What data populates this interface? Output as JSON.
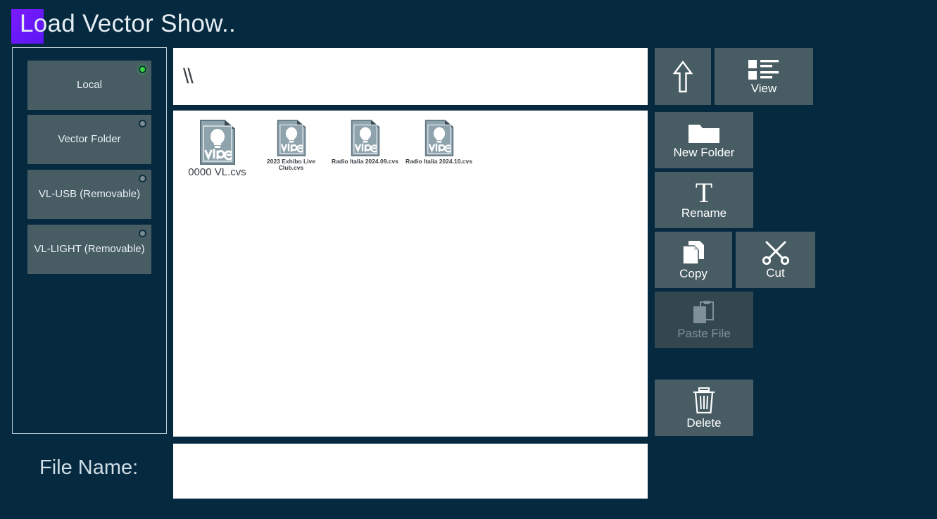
{
  "window": {
    "title": "Load Vector Show..",
    "accent_color": "#6a18fb",
    "background_color": "#05293f",
    "button_color": "#475c63",
    "panel_color": "#ffffff"
  },
  "sidebar": {
    "items": [
      {
        "label": "Local",
        "indicator": "led-icon",
        "active": true
      },
      {
        "label": "Vector Folder",
        "indicator": "led-icon",
        "active": false
      },
      {
        "label": "VL-USB (Removable)",
        "indicator": "led-icon",
        "active": false
      },
      {
        "label": "VL-LIGHT (Removable)",
        "indicator": "led-icon",
        "active": false
      }
    ]
  },
  "path_bar": {
    "value": "\\\\"
  },
  "files": [
    {
      "name": "0000 VL.cvs",
      "icon": "vibe-document-icon",
      "size": "big"
    },
    {
      "name": "2023 Exhibo Live Club.cvs",
      "icon": "vibe-document-icon",
      "size": "small"
    },
    {
      "name": "Radio Italia 2024.09.cvs",
      "icon": "vibe-document-icon",
      "size": "small"
    },
    {
      "name": "Radio Italia 2024.10.cvs",
      "icon": "vibe-document-icon",
      "size": "small"
    }
  ],
  "toolbar": {
    "up_label": "",
    "view_label": "View",
    "new_folder_label": "New Folder",
    "rename_label": "Rename",
    "copy_label": "Copy",
    "cut_label": "Cut",
    "paste_label": "Paste File",
    "paste_enabled": false,
    "delete_label": "Delete"
  },
  "filename": {
    "label": "File Name:",
    "value": "",
    "placeholder": ""
  }
}
